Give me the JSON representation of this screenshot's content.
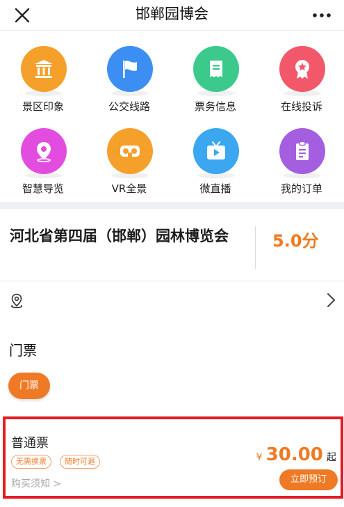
{
  "header": {
    "title": "邯郸园博会",
    "close_icon": "close-icon",
    "more_icon": "more-icon"
  },
  "grid": {
    "items": [
      {
        "label": "景区印象",
        "icon": "temple-icon",
        "color": "#f5a02a"
      },
      {
        "label": "公交线路",
        "icon": "flag-icon",
        "color": "#3d8ef3"
      },
      {
        "label": "票务信息",
        "icon": "ticket-icon",
        "color": "#3cc98c"
      },
      {
        "label": "在线投诉",
        "icon": "badge-icon",
        "color": "#f3586a"
      },
      {
        "label": "智慧导览",
        "icon": "map-pin-icon",
        "color": "#e24de0"
      },
      {
        "label": "VR全景",
        "icon": "vr-glasses-icon",
        "color": "#f5a02a"
      },
      {
        "label": "微直播",
        "icon": "tv-play-icon",
        "color": "#3aa7f0"
      },
      {
        "label": "我的订单",
        "icon": "clipboard-icon",
        "color": "#a45ee0"
      }
    ]
  },
  "attraction": {
    "name": "河北省第四届（邯郸）园林博览会",
    "score": "5.0分"
  },
  "location": {
    "pin_icon": "location-pin-icon",
    "arrow_icon": "chevron-right-icon"
  },
  "tickets": {
    "heading": "门票",
    "chip": "门票"
  },
  "ticket_card": {
    "name": "普通票",
    "tags": [
      "无需换票",
      "随时可退"
    ],
    "notice": "购买须知 >",
    "currency": "¥",
    "price": "30.00",
    "suffix": "起",
    "book": "立即预订"
  },
  "colors": {
    "accent": "#ef7a25",
    "highlight_border": "#e81b22",
    "separator": "#eef0f3"
  }
}
